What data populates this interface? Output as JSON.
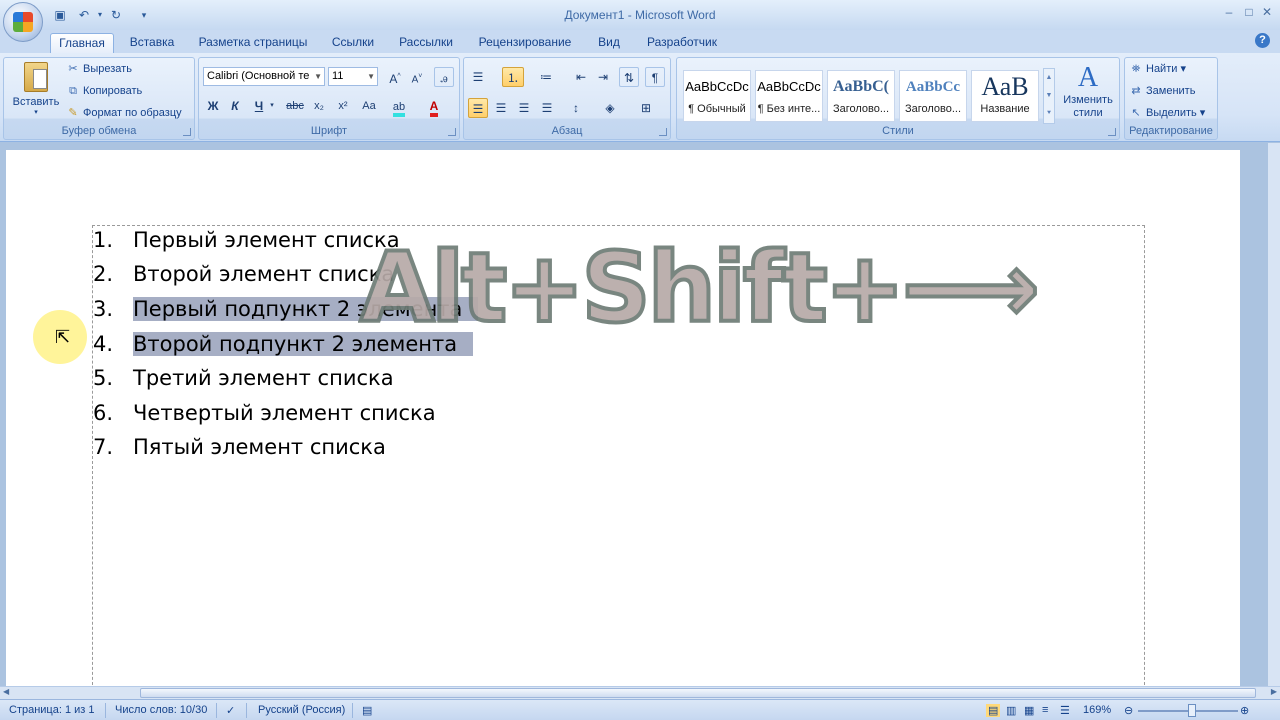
{
  "window": {
    "title": "Документ1 - Microsoft Word",
    "controls": {
      "minimize": "–",
      "maximize": "□",
      "close": "✕"
    }
  },
  "quick_access": [
    {
      "icon": "save-icon",
      "glyph": "💾"
    },
    {
      "icon": "undo-icon",
      "glyph": "↶"
    },
    {
      "icon": "redo-icon",
      "glyph": "↻"
    },
    {
      "icon": "customize-icon",
      "glyph": "▾"
    }
  ],
  "tabs": [
    "Главная",
    "Вставка",
    "Разметка страницы",
    "Ссылки",
    "Рассылки",
    "Рецензирование",
    "Вид",
    "Разработчик"
  ],
  "ribbon": {
    "clipboard": {
      "label": "Буфер обмена",
      "paste": "Вставить",
      "cut": "Вырезать",
      "copy": "Копировать",
      "format_painter": "Формат по образцу"
    },
    "font": {
      "label": "Шрифт",
      "font_name": "Calibri (Основной те",
      "font_size": "11",
      "bold": "Ж",
      "italic": "К",
      "underline": "Ч",
      "strikethrough": "abc",
      "subscript": "x₂",
      "superscript": "x²",
      "change_case": "Aa"
    },
    "paragraph": {
      "label": "Абзац"
    },
    "styles": {
      "label": "Стили",
      "tiles": [
        {
          "preview": "AaBbCcDc",
          "name": "¶ Обычный"
        },
        {
          "preview": "AaBbCcDc",
          "name": "¶ Без инте..."
        },
        {
          "preview": "AaBbC(",
          "name": "Заголово..."
        },
        {
          "preview": "AaBbCc",
          "name": "Заголово..."
        },
        {
          "preview": "АаВ",
          "name": "Название"
        }
      ],
      "change_styles": "Изменить стили"
    },
    "editing": {
      "label": "Редактирование",
      "find": "Найти",
      "replace": "Заменить",
      "select": "Выделить"
    }
  },
  "document": {
    "items": [
      {
        "num": "1.",
        "text": "Первый элемент списка",
        "selected": false
      },
      {
        "num": "2.",
        "text": "Второй элемент списка",
        "selected": false
      },
      {
        "num": "3.",
        "text": "Первый подпункт 2 элемента",
        "selected": true
      },
      {
        "num": "4.",
        "text": "Второй подпункт 2 элемента",
        "selected": true
      },
      {
        "num": "5.",
        "text": "Третий элемент списка",
        "selected": false
      },
      {
        "num": "6.",
        "text": "Четвертый элемент списка",
        "selected": false
      },
      {
        "num": "7.",
        "text": "Пятый элемент списка",
        "selected": false
      }
    ],
    "shortcut_overlay": "Alt+Shift+⟶"
  },
  "status_bar": {
    "page": "Страница: 1 из 1",
    "words": "Число слов: 10/30",
    "language": "Русский (Россия)",
    "zoom": "169%"
  },
  "colors": {
    "selection": "#a6aec4",
    "ribbon_text": "#15428b",
    "overlay_fill": "#b7aaa8",
    "overlay_stroke": "#6e7c76"
  }
}
